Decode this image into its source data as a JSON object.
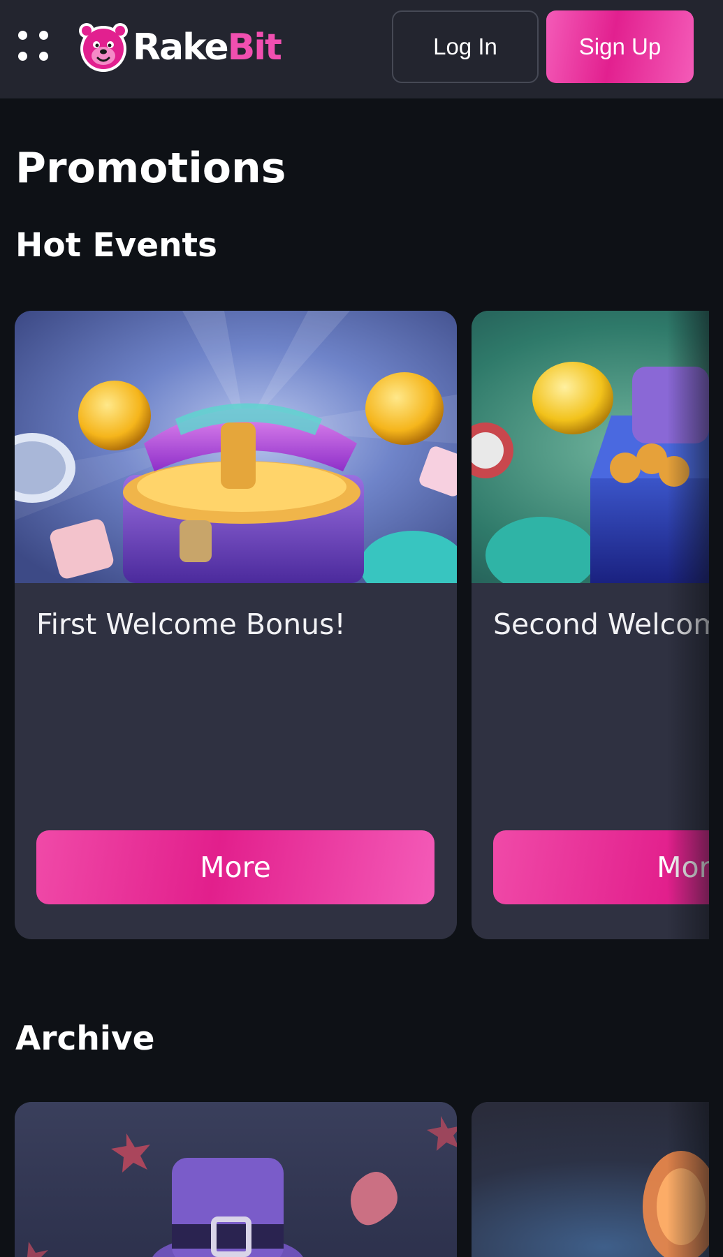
{
  "header": {
    "brand_first": "Rake",
    "brand_second": "Bit",
    "login_label": "Log In",
    "signup_label": "Sign Up"
  },
  "page_title": "Promotions",
  "hot_events": {
    "title": "Hot Events",
    "cards": [
      {
        "title": "First Welcome Bonus!",
        "button": "More"
      },
      {
        "title": "Second Welcome Bonus!",
        "button": "More"
      }
    ]
  },
  "archive": {
    "title": "Archive"
  },
  "colors": {
    "accent": "#e2208f",
    "background": "#0e1116",
    "header": "#23252f",
    "card": "#2f3141"
  }
}
